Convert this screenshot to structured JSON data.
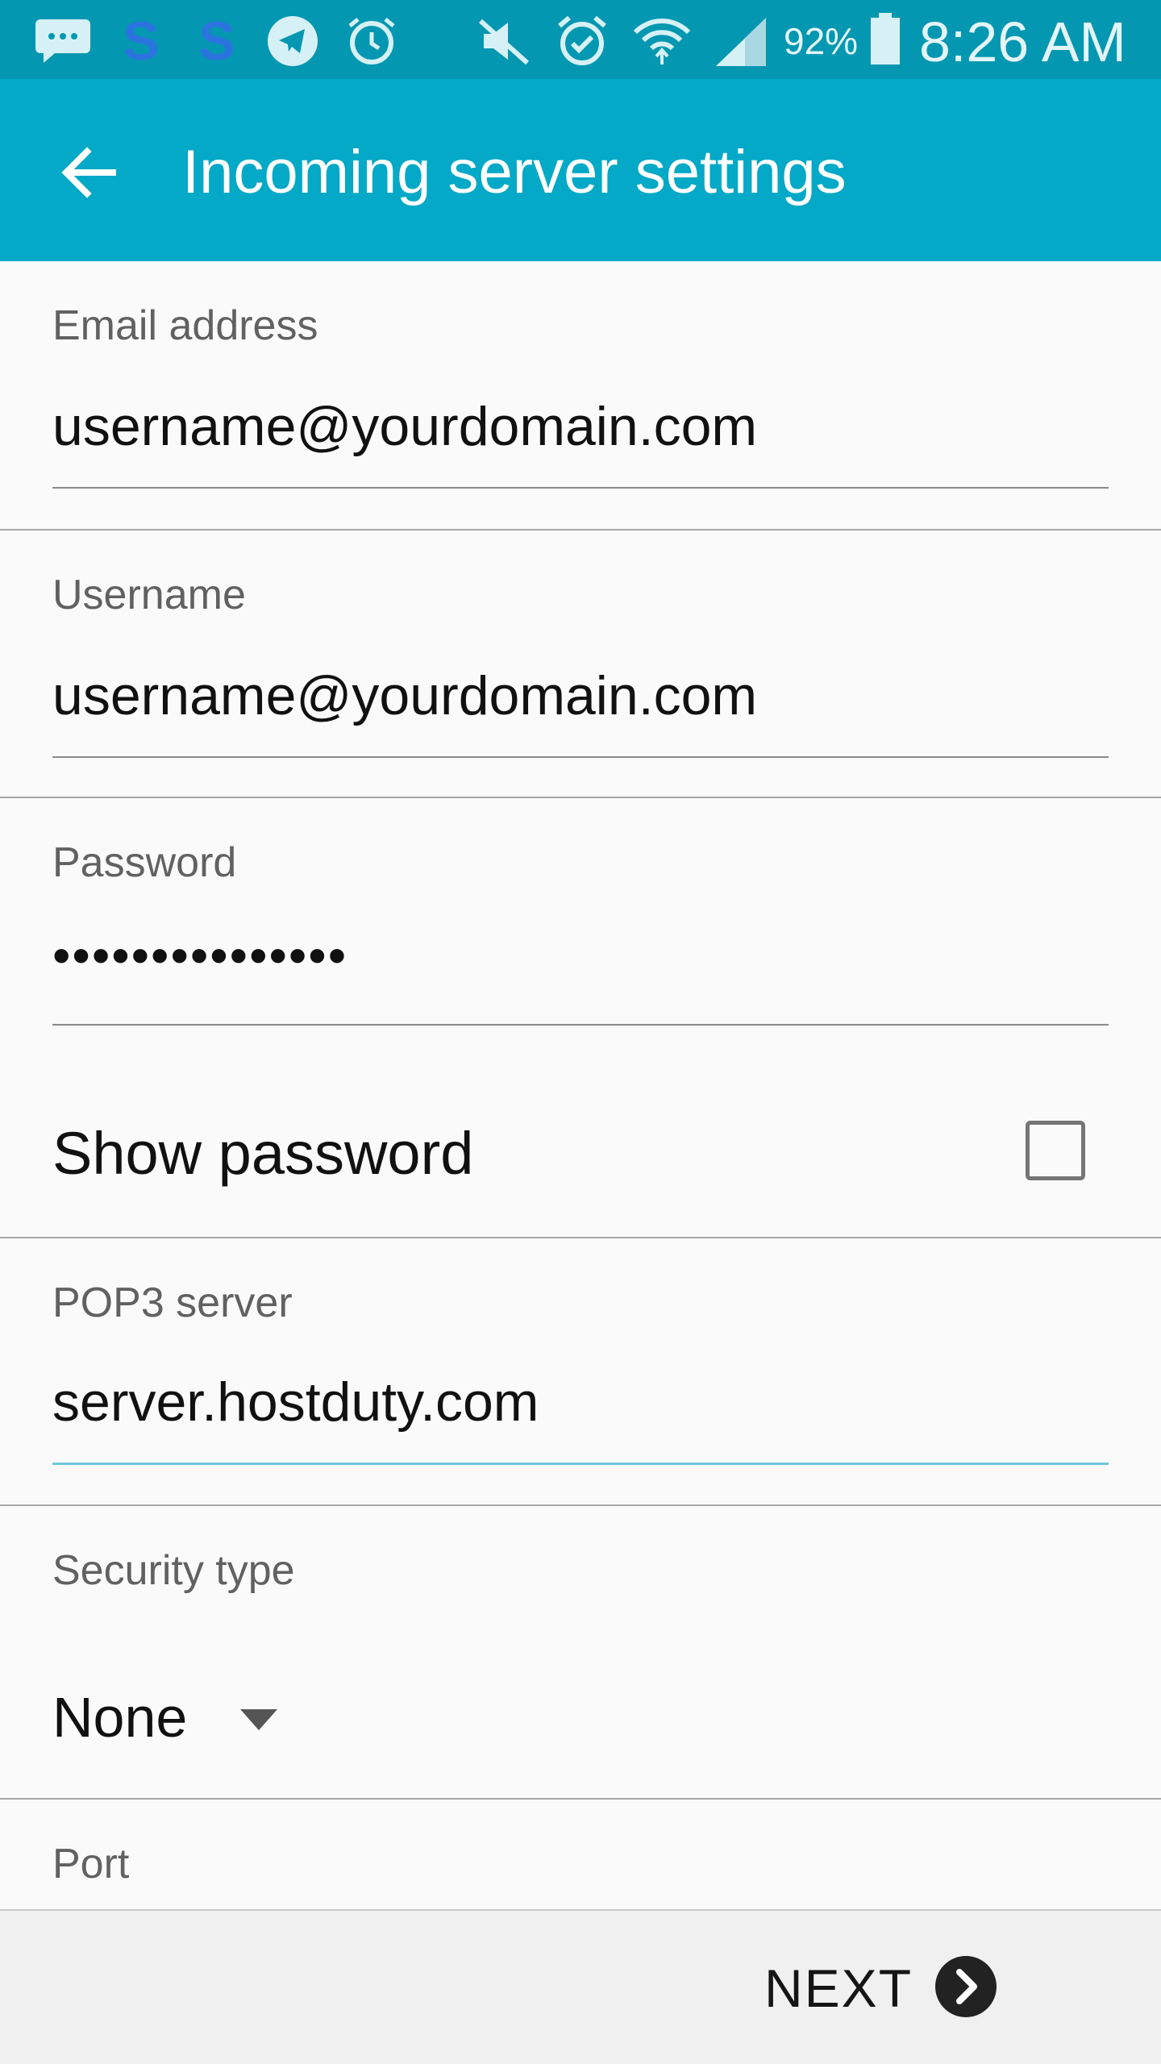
{
  "status_bar": {
    "battery": "92%",
    "time": "8:26 AM",
    "icons": [
      "messages-icon",
      "skype-icon",
      "skype-icon",
      "telegram-icon",
      "alarm-history-icon",
      "mute-icon",
      "alarm-icon",
      "wifi-icon",
      "signal-icon",
      "battery-icon"
    ]
  },
  "app_bar": {
    "title": "Incoming server settings",
    "back_icon": "back-arrow-icon"
  },
  "form": {
    "email": {
      "label": "Email address",
      "value": "username@yourdomain.com"
    },
    "username": {
      "label": "Username",
      "value": "username@yourdomain.com"
    },
    "password": {
      "label": "Password",
      "value": "•••••••••••••••"
    },
    "show_password": {
      "label": "Show password",
      "checked": false
    },
    "pop3_server": {
      "label": "POP3 server",
      "value": "server.hostduty.com"
    },
    "security_type": {
      "label": "Security type",
      "value": "None"
    },
    "port": {
      "label": "Port"
    }
  },
  "footer": {
    "next_label": "NEXT",
    "next_icon": "chevron-right-icon"
  },
  "colors": {
    "status_bar": "#0497b1",
    "app_bar": "#03a9c6",
    "accent_underline": "#6fc7d8"
  }
}
